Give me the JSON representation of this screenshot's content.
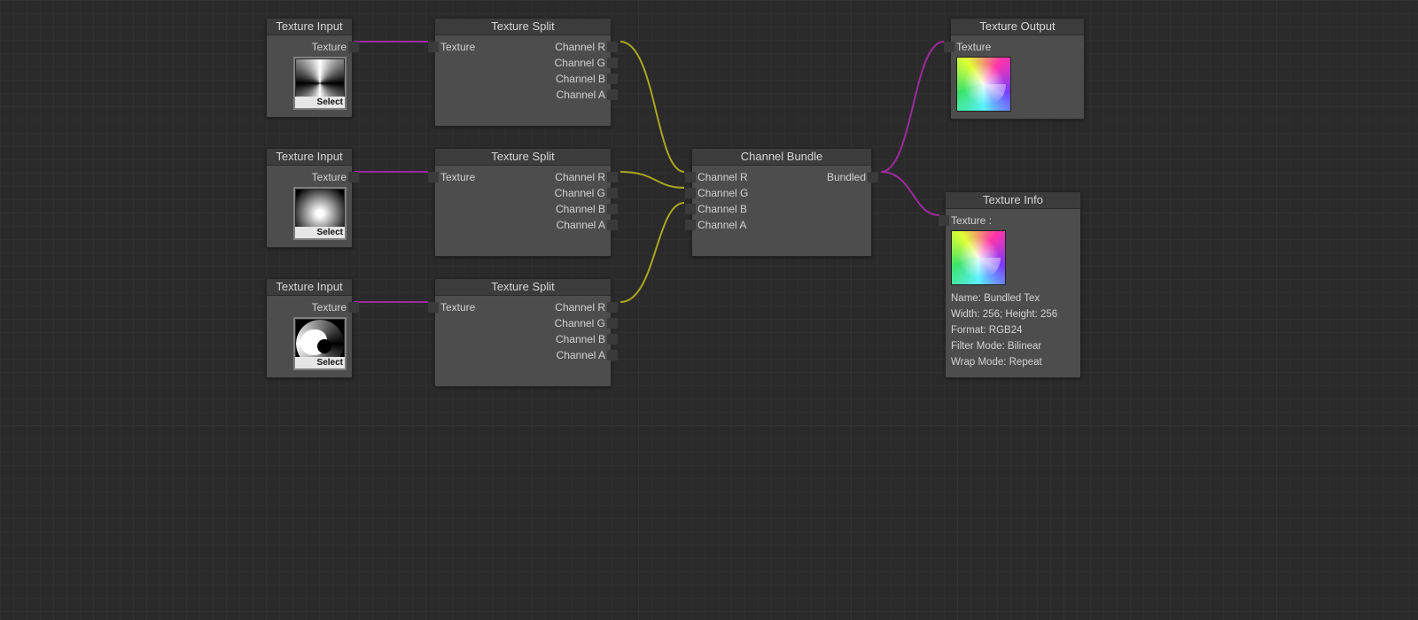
{
  "labels": {
    "select": "Select"
  },
  "colors": {
    "texturePort": "#9c2a9c",
    "channelPort": "#a8a81e",
    "nodeBg": "#4d4d4d",
    "nodeHeader": "#3c3c3c",
    "canvasBg": "#2a2a2a"
  },
  "nodes": {
    "textureInput1": {
      "title": "Texture Input",
      "outputs": [
        "Texture"
      ],
      "thumbnail": "conic-grayscale"
    },
    "textureInput2": {
      "title": "Texture Input",
      "outputs": [
        "Texture"
      ],
      "thumbnail": "radial-glow"
    },
    "textureInput3": {
      "title": "Texture Input",
      "outputs": [
        "Texture"
      ],
      "thumbnail": "spiral-grayscale"
    },
    "textureSplit1": {
      "title": "Texture Split",
      "inputs": [
        "Texture"
      ],
      "outputs": [
        "Channel R",
        "Channel G",
        "Channel B",
        "Channel A"
      ]
    },
    "textureSplit2": {
      "title": "Texture Split",
      "inputs": [
        "Texture"
      ],
      "outputs": [
        "Channel R",
        "Channel G",
        "Channel B",
        "Channel A"
      ]
    },
    "textureSplit3": {
      "title": "Texture Split",
      "inputs": [
        "Texture"
      ],
      "outputs": [
        "Channel R",
        "Channel G",
        "Channel B",
        "Channel A"
      ]
    },
    "channelBundle": {
      "title": "Channel Bundle",
      "inputs": [
        "Channel R",
        "Channel G",
        "Channel B",
        "Channel A"
      ],
      "outputs": [
        "Bundled"
      ]
    },
    "textureOutput": {
      "title": "Texture Output",
      "inputs": [
        "Texture"
      ],
      "thumbnail": "color-spiral"
    },
    "textureInfo": {
      "title": "Texture Info",
      "inputs": [
        "Texture :"
      ],
      "thumbnail": "color-spiral",
      "info": {
        "name": "Name: Bundled Tex",
        "size": "Width: 256; Height: 256",
        "format": "Format: RGB24",
        "filter": "Filter Mode: Bilinear",
        "wrap": "Wrap Mode: Repeat"
      }
    }
  },
  "connections": [
    {
      "from": "textureInput1.Texture",
      "to": "textureSplit1.Texture",
      "color": "texturePort"
    },
    {
      "from": "textureInput2.Texture",
      "to": "textureSplit2.Texture",
      "color": "texturePort"
    },
    {
      "from": "textureInput3.Texture",
      "to": "textureSplit3.Texture",
      "color": "texturePort"
    },
    {
      "from": "textureSplit1.Channel R",
      "to": "channelBundle.Channel R",
      "color": "channelPort"
    },
    {
      "from": "textureSplit2.Channel R",
      "to": "channelBundle.Channel G",
      "color": "channelPort"
    },
    {
      "from": "textureSplit3.Channel R",
      "to": "channelBundle.Channel B",
      "color": "channelPort"
    },
    {
      "from": "channelBundle.Bundled",
      "to": "textureOutput.Texture",
      "color": "texturePort"
    },
    {
      "from": "channelBundle.Bundled",
      "to": "textureInfo.Texture",
      "color": "texturePort"
    }
  ]
}
